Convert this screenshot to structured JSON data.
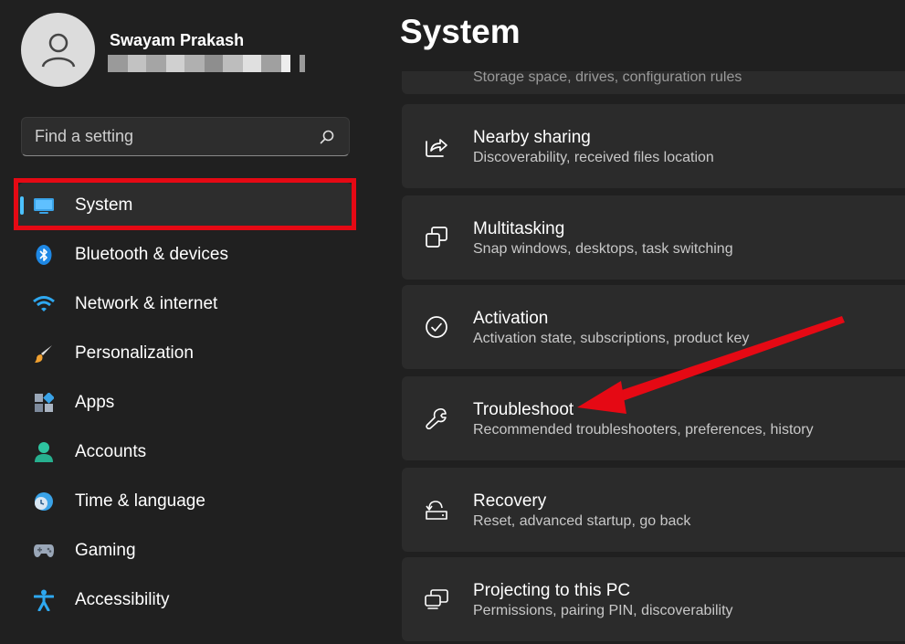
{
  "user": {
    "name": "Swayam Prakash",
    "email_obscured": true
  },
  "search": {
    "placeholder": "Find a setting",
    "icon": "search-icon"
  },
  "sidebar": {
    "items": [
      {
        "label": "System",
        "icon": "monitor-icon",
        "active": true
      },
      {
        "label": "Bluetooth & devices",
        "icon": "bluetooth-icon"
      },
      {
        "label": "Network & internet",
        "icon": "wifi-icon"
      },
      {
        "label": "Personalization",
        "icon": "brush-icon"
      },
      {
        "label": "Apps",
        "icon": "apps-icon"
      },
      {
        "label": "Accounts",
        "icon": "account-icon"
      },
      {
        "label": "Time & language",
        "icon": "clock-globe-icon"
      },
      {
        "label": "Gaming",
        "icon": "gamepad-icon"
      },
      {
        "label": "Accessibility",
        "icon": "accessibility-icon"
      }
    ]
  },
  "main": {
    "title": "System",
    "partial_card_desc": "Storage space, drives, configuration rules",
    "cards": [
      {
        "title": "Nearby sharing",
        "desc": "Discoverability, received files location",
        "icon": "share-icon"
      },
      {
        "title": "Multitasking",
        "desc": "Snap windows, desktops, task switching",
        "icon": "multitasking-icon"
      },
      {
        "title": "Activation",
        "desc": "Activation state, subscriptions, product key",
        "icon": "check-circle-icon"
      },
      {
        "title": "Troubleshoot",
        "desc": "Recommended troubleshooters, preferences, history",
        "icon": "wrench-icon"
      },
      {
        "title": "Recovery",
        "desc": "Reset, advanced startup, go back",
        "icon": "recovery-icon"
      },
      {
        "title": "Projecting to this PC",
        "desc": "Permissions, pairing PIN, discoverability",
        "icon": "projecting-icon"
      }
    ]
  },
  "annotations": {
    "highlight_color": "#e50914",
    "arrow_color": "#e50914"
  },
  "colors": {
    "background": "#202020",
    "card": "#2b2b2b",
    "accent": "#4cc2ff"
  }
}
